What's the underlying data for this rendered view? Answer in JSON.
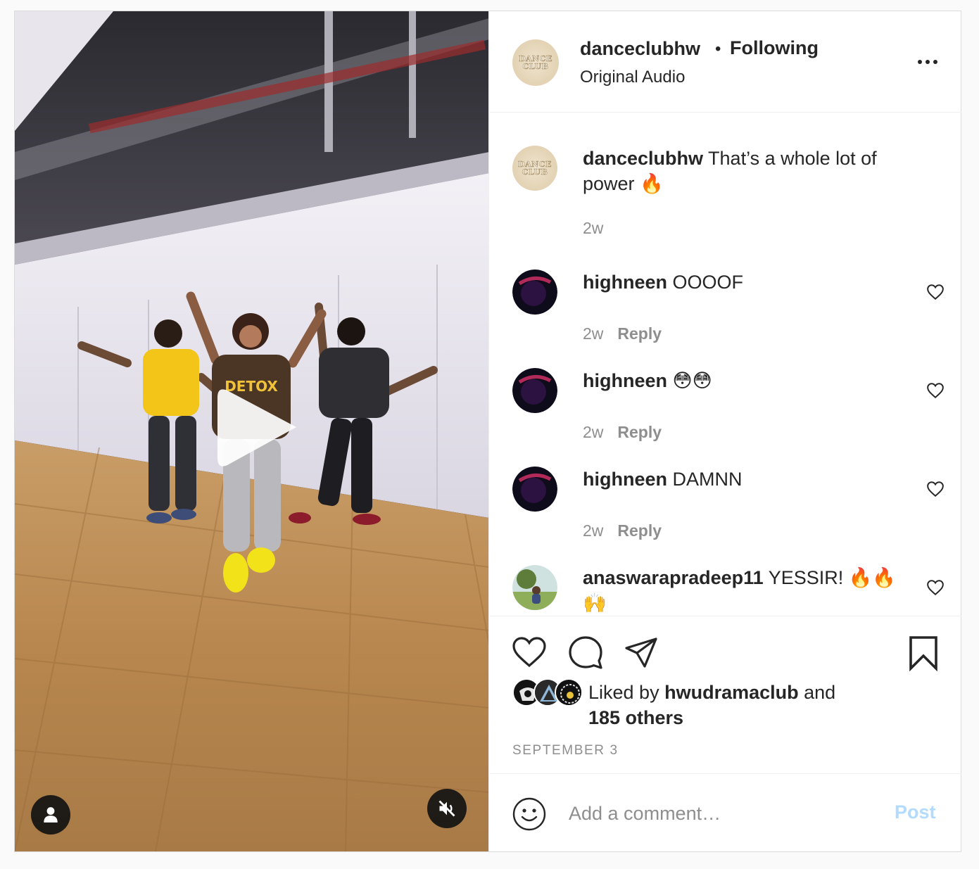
{
  "post": {
    "header": {
      "username": "danceclubhw",
      "separator": "•",
      "follow_status": "Following",
      "audio": "Original Audio",
      "avatar_text": [
        "DANCE",
        "CLUB"
      ]
    },
    "caption": {
      "username": "danceclubhw",
      "text": "That’s a whole lot of power 🔥",
      "time": "2w"
    },
    "comments": [
      {
        "username": "highneen",
        "text": "OOOOF",
        "time": "2w",
        "reply": "Reply"
      },
      {
        "username": "highneen",
        "text": "😳😳",
        "time": "2w",
        "reply": "Reply"
      },
      {
        "username": "highneen",
        "text": "DAMNN",
        "time": "2w",
        "reply": "Reply"
      },
      {
        "username": "anaswarapradeep11",
        "text": "YESSIR! 🔥🔥🙌",
        "time": "",
        "reply": ""
      }
    ],
    "likes": {
      "prefix": "Liked by",
      "top_liker": "hwudramaclub",
      "and": "and",
      "others": "185 others"
    },
    "date": "SEPTEMBER 3",
    "add_comment": {
      "placeholder": "Add a comment…",
      "post_label": "Post"
    }
  },
  "icons": {
    "like": "heart-icon",
    "comment": "comment-bubble-icon",
    "share": "paper-plane-icon",
    "save": "bookmark-icon",
    "emoji": "smiley-icon",
    "play": "play-icon",
    "user_tag": "person-icon",
    "mute": "speaker-muted-icon",
    "more": "more-dots-icon"
  },
  "colors": {
    "text": "#262626",
    "secondary": "#8e8e8e",
    "border": "#dbdbdb",
    "post_button_disabled": "#b3dbff"
  }
}
